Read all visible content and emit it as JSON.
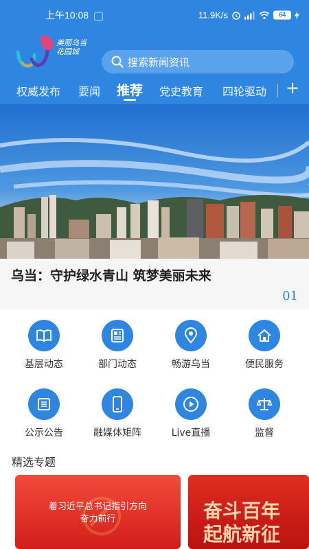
{
  "status": {
    "time": "上午10:08",
    "network_speed": "11.9K/s",
    "battery": "64"
  },
  "logo": {
    "text": "美丽乌当 花园城"
  },
  "search": {
    "placeholder": "搜索新闻资讯"
  },
  "tabs": [
    {
      "label": "权威发布"
    },
    {
      "label": "要闻"
    },
    {
      "label": "推荐"
    },
    {
      "label": "党史教育"
    },
    {
      "label": "四轮驱动"
    }
  ],
  "add_tab": "+",
  "headline": {
    "title": "乌当：守护绿水青山 筑梦美丽未来",
    "index": "01"
  },
  "services": [
    {
      "label": "基层动态",
      "icon": "book-icon"
    },
    {
      "label": "部门动态",
      "icon": "newspaper-icon"
    },
    {
      "label": "畅游乌当",
      "icon": "location-pin-icon"
    },
    {
      "label": "便民服务",
      "icon": "home-icon"
    },
    {
      "label": "公示公告",
      "icon": "notice-board-icon"
    },
    {
      "label": "融媒体矩阵",
      "icon": "phone-icon"
    },
    {
      "label": "Live直播",
      "icon": "play-icon"
    },
    {
      "label": "监督",
      "icon": "scales-icon"
    }
  ],
  "section": {
    "title": "精选专题"
  },
  "cards": [
    {
      "text_line1": "着习近平总书记指引方向",
      "text_line2": "奋力前行"
    },
    {
      "text_line1": "奋斗百年",
      "text_line2": "起航新征"
    }
  ],
  "colors": {
    "primary": "#2f86e0",
    "card_red": "#d21d1a"
  }
}
